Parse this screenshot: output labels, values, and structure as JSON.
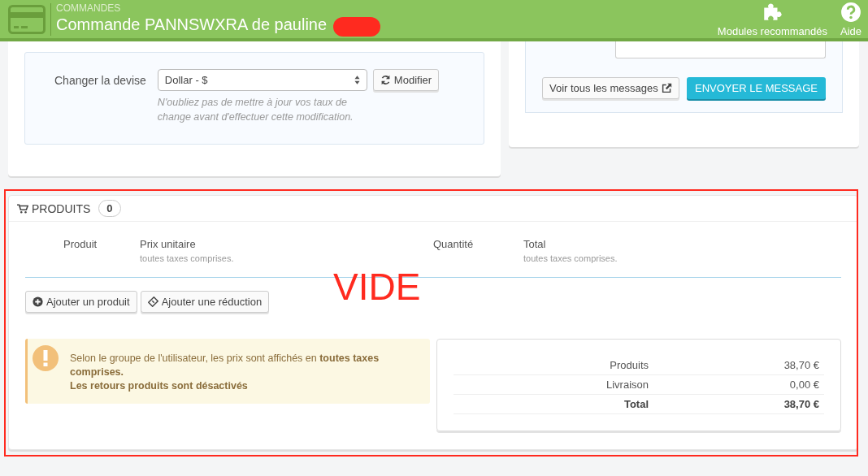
{
  "header": {
    "breadcrumb": "COMMANDES",
    "title": "Commande PANNSWXRA de pauline",
    "redacted": true,
    "actions": [
      {
        "label": "Modules recommandés",
        "kind": "puzzle"
      },
      {
        "label": "Aide",
        "kind": "help"
      }
    ]
  },
  "currency": {
    "label": "Changer la devise",
    "value": "Dollar - $",
    "button": "Modifier",
    "help": "N'oubliez pas de mettre à jour vos taux de change avant d'effectuer cette modification."
  },
  "messages": {
    "view_all": "Voir tous les messages",
    "send": "ENVOYER LE MESSAGE"
  },
  "products": {
    "title": "PRODUITS",
    "count": "0",
    "columns": [
      {
        "label": "Produit"
      },
      {
        "label": "Prix unitaire",
        "note": "toutes taxes comprises."
      },
      {
        "label": "Quantité"
      },
      {
        "label": "Total",
        "note": "toutes taxes comprises."
      }
    ],
    "buttons": [
      {
        "label": "Ajouter un produit",
        "kind": "add"
      },
      {
        "label": "Ajouter une réduction",
        "kind": "ticket"
      }
    ],
    "alert": {
      "text": "Selon le groupe de l'utilisateur, les prix sont affichés en **toutes taxes comprises.**",
      "note": "Les retours produits sont désactivés"
    },
    "summary": [
      {
        "label": "Produits",
        "value": "38,70 €",
        "kind": "line"
      },
      {
        "label": "Livraison",
        "value": "0,00 €",
        "kind": "line"
      },
      {
        "label": "Total",
        "value": "38,70 €",
        "kind": "total"
      }
    ]
  },
  "annotation": {
    "label": "VIDE"
  }
}
